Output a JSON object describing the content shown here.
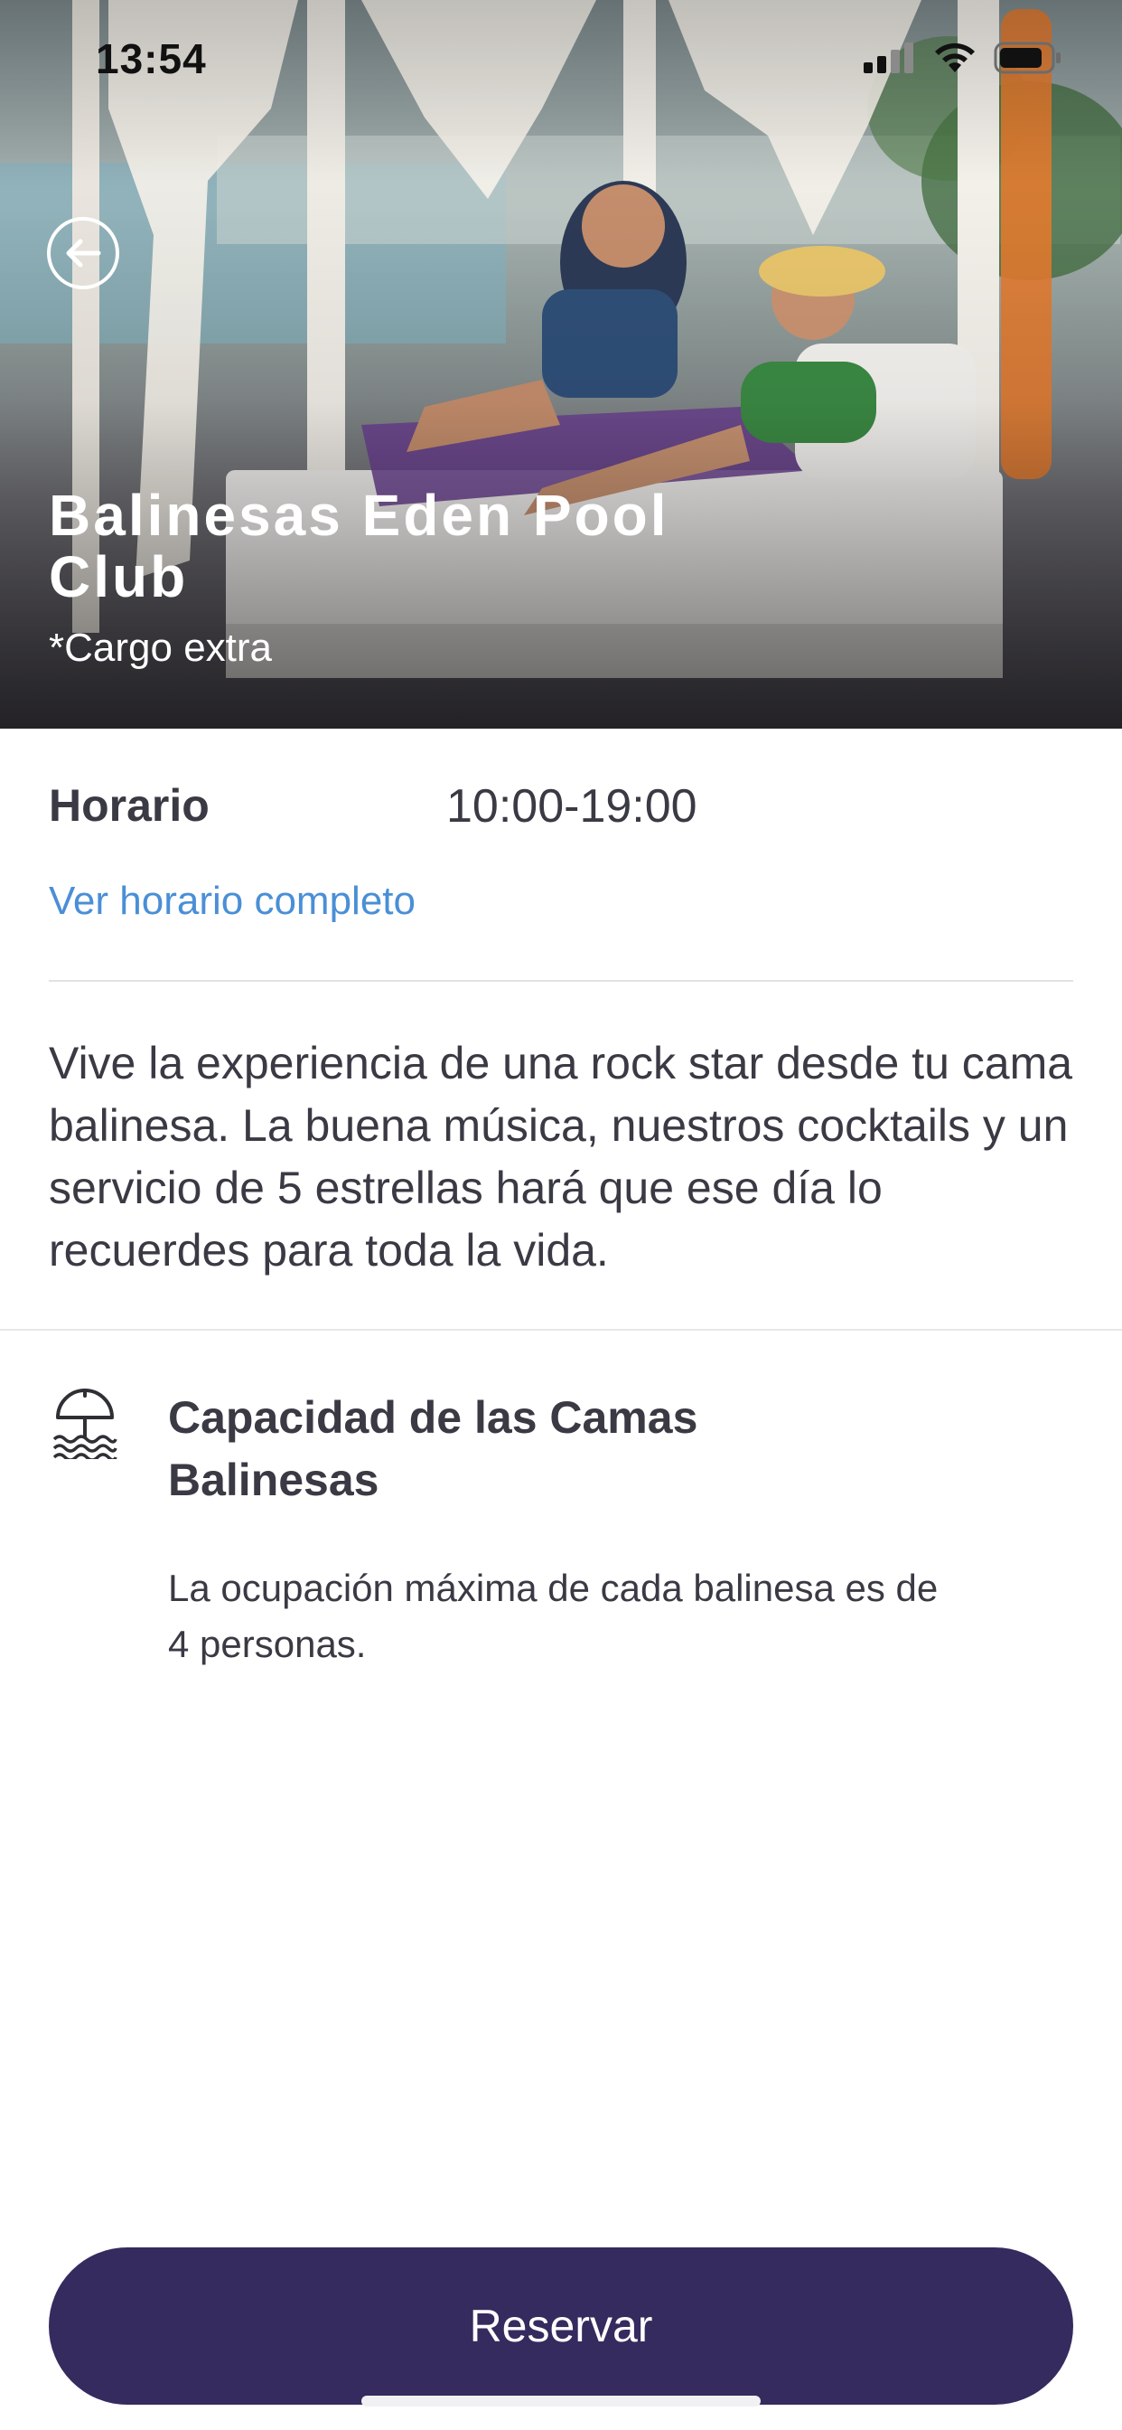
{
  "status_bar": {
    "time": "13:54"
  },
  "hero": {
    "title": "Balinesas Eden Pool Club",
    "subtitle": "*Cargo extra"
  },
  "hours": {
    "label": "Horario",
    "value": "10:00-19:00",
    "link_label": "Ver horario completo"
  },
  "description": "Vive la experiencia de una rock star desde tu cama balinesa. La buena música, nuestros cocktails y un servicio de 5 estrellas hará que ese día lo recuerdes para toda la vida.",
  "capacity": {
    "icon": "beach-umbrella-icon",
    "title": "Capacidad de las Camas Balinesas",
    "text": "La ocupación máxima de cada balinesa es de 4 personas."
  },
  "actions": {
    "reserve_label": "Reservar"
  },
  "colors": {
    "primary_button": "#352b5e",
    "link": "#4a8fd6",
    "text": "#3a3a44"
  }
}
